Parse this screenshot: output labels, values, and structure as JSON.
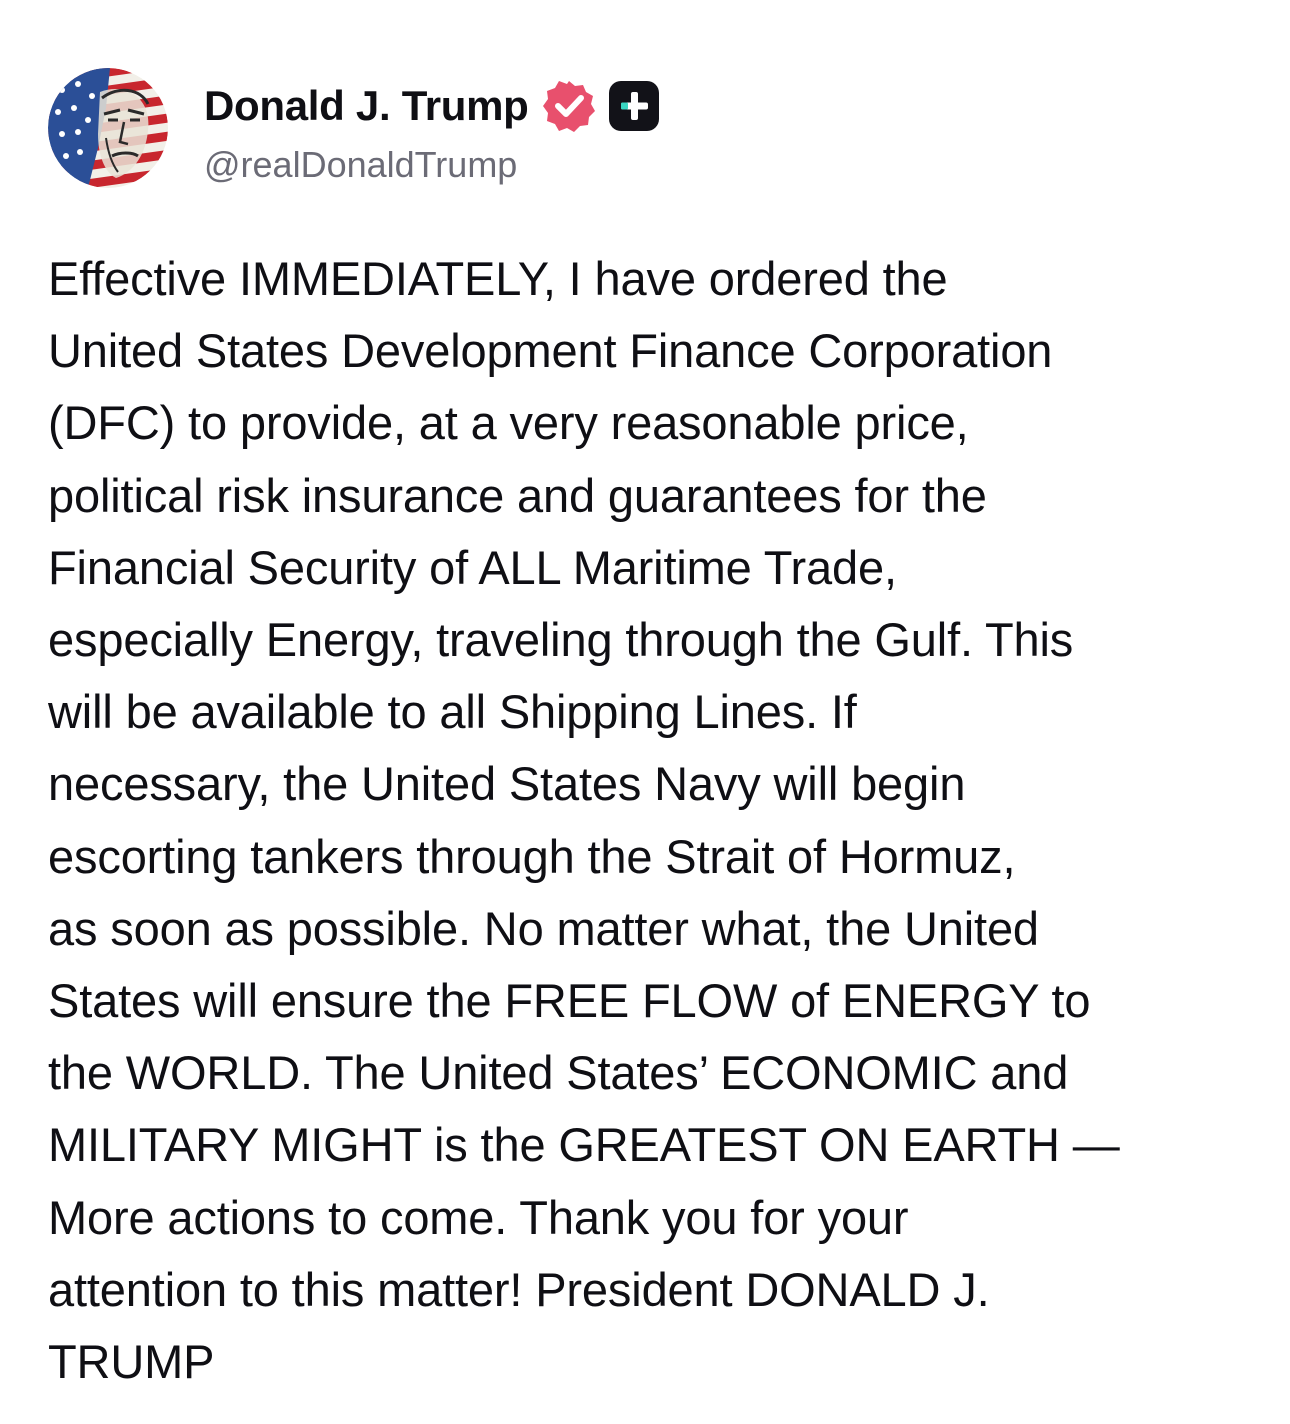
{
  "post": {
    "author": {
      "display_name": "Donald J. Trump",
      "handle": "@realDonaldTrump",
      "verified_icon": "verified-badge-icon",
      "plus_icon": "plus-badge-icon",
      "verified_color": "#e8506d",
      "plus_badge_color": "#121218",
      "plus_badge_accent": "#3ad6c2"
    },
    "body_lines": [
      "Effective IMMEDIATELY, I have ordered the",
      "United States Development Finance Corporation",
      "(DFC) to provide, at a very reasonable price,",
      "political risk insurance and guarantees for the",
      "Financial Security of ALL Maritime Trade,",
      "especially Energy, traveling through the Gulf. This",
      "will be available to all Shipping Lines. If",
      "necessary, the United States Navy will begin",
      "escorting tankers through the Strait of Hormuz,",
      "as soon as possible. No matter what, the United",
      "States will ensure the FREE FLOW of ENERGY to",
      "the WORLD. The United States’ ECONOMIC and",
      "MILITARY MIGHT is the GREATEST ON EARTH —",
      "More actions to come. Thank you for your",
      "attention to this matter! President DONALD J.",
      "TRUMP"
    ]
  }
}
